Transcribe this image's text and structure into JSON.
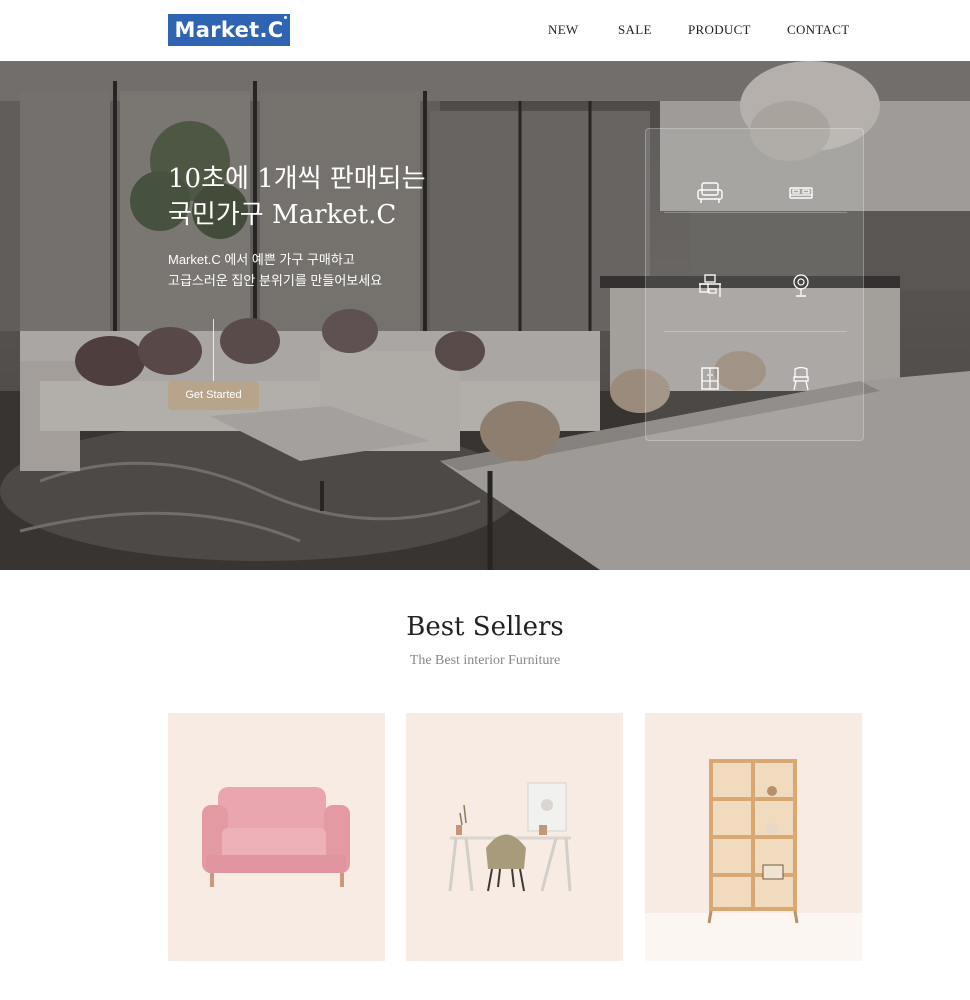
{
  "header": {
    "logo_text": "Market.C",
    "nav": [
      "NEW",
      "SALE",
      "PRODUCT",
      "CONTACT"
    ]
  },
  "hero": {
    "title_lines": [
      "10초에 1개씩 판매되는",
      "국민가구 Market.C"
    ],
    "subtitle_lines": [
      "Market.C 에서 예쁜 가구 구매하고",
      "고급스러운 집안 분위기를 만들어보세요"
    ],
    "cta_label": "Get Started",
    "category_icons": [
      "armchair-icon",
      "bed-icon",
      "desk-icon",
      "lamp-icon",
      "wardrobe-icon",
      "chair-icon"
    ]
  },
  "best_sellers": {
    "title": "Best Sellers",
    "subtitle": "The Best interior Furniture",
    "products": [
      "pink-sofa",
      "desk-with-chair",
      "wooden-bookshelf"
    ]
  },
  "colors": {
    "brand": "#2f64b3",
    "cta": "#b8a48a",
    "card_bg": "#f7ebe3"
  }
}
